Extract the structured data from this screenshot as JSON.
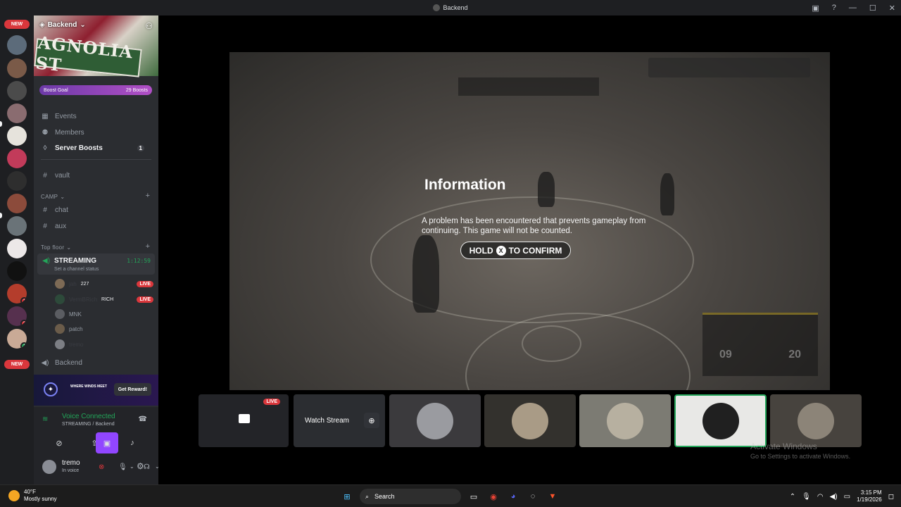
{
  "window": {
    "title": "Backend"
  },
  "rail": {
    "new_label_top": "NEW",
    "new_label_bottom": "NEW",
    "badges": [
      "1",
      "3",
      "1"
    ]
  },
  "server": {
    "name": "Backend",
    "banner_sign": "AGNOLIA ST",
    "boost_goal": "Boost Goal",
    "boost_count": "29 Boosts",
    "nav": [
      {
        "label": "Events",
        "icon": "calendar-icon"
      },
      {
        "label": "Members",
        "icon": "members-icon"
      },
      {
        "label": "Server Boosts",
        "icon": "boost-icon",
        "count": "1"
      }
    ],
    "vault_channel": "vault",
    "camp_category": "CAMP",
    "camp_channels": [
      "chat",
      "aux"
    ],
    "top_floor_category": "Top floor",
    "streaming_channel": "STREAMING",
    "streaming_status": "Set a channel status",
    "streaming_timer": "1:12:59",
    "voice_users": [
      {
        "name": "jah",
        "extra": "227",
        "live": "LIVE"
      },
      {
        "name": "VermBRich",
        "extra": "RICH",
        "live": "LIVE"
      },
      {
        "name": "MNK"
      },
      {
        "name": "patch"
      },
      {
        "name": "tremo"
      }
    ],
    "backend_channel": "Backend"
  },
  "promo": {
    "text": "WHERE WINDS MEET",
    "button": "Get Reward!"
  },
  "voice": {
    "status": "Voice Connected",
    "location": "STREAMING / Backend",
    "user": "tremo",
    "user_status": "In voice"
  },
  "game": {
    "title": "Information",
    "message": "A problem has been encountered that prevents gameplay from continuing. This game will not be counted.",
    "button_hold": "HOLD",
    "button_key": "X",
    "button_action": "TO CONFIRM",
    "score_left": "09",
    "score_right": "20"
  },
  "tiles": {
    "live": "LIVE",
    "watch_stream": "Watch Stream"
  },
  "windows_watermark": {
    "title": "Activate Windows",
    "subtitle": "Go to Settings to activate Windows."
  },
  "taskbar": {
    "temperature": "40°F",
    "weather": "Mostly sunny",
    "search_placeholder": "Search",
    "time": "3:15 PM",
    "date": "1/19/2026"
  }
}
